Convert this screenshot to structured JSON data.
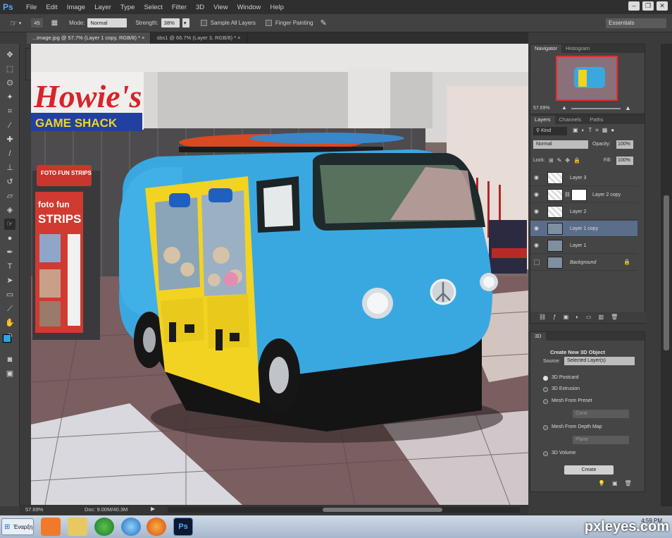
{
  "app": {
    "logo": "Ps"
  },
  "menu": [
    "File",
    "Edit",
    "Image",
    "Layer",
    "Type",
    "Select",
    "Filter",
    "3D",
    "View",
    "Window",
    "Help"
  ],
  "window_controls": {
    "minimize": "–",
    "restore": "❐",
    "close": "✕"
  },
  "options": {
    "brush_size": "45",
    "mode_label": "Mode:",
    "mode_value": "Normal",
    "strength_label": "Strength:",
    "strength_value": "38%",
    "sample_all_layers": "Sample All Layers",
    "finger_painting": "Finger Painting",
    "workspace": "Essentials"
  },
  "tabs": [
    {
      "label": "...image.jpg @ 57.7% (Layer 1 copy, RGB/8) * ×",
      "active": true
    },
    {
      "label": "sbs1 @ 66.7% (Layer 3, RGB/8) * ×",
      "active": false
    }
  ],
  "canvas_scene": {
    "sign_main": "Howie's",
    "sign_sub": "GAME SHACK",
    "booth_top": "FOTO FUN STRIPS",
    "booth_mid": "foto fun",
    "booth_big": "STRIPS"
  },
  "status": {
    "zoom": "57.69%",
    "doc": "Doc: 9.00M/40.3M"
  },
  "navigator": {
    "tabs": [
      "Navigator",
      "Histogram"
    ],
    "zoom": "57.69%"
  },
  "layers_panel": {
    "tabs": [
      "Layers",
      "Channels",
      "Paths"
    ],
    "kind": "Kind",
    "blend": "Normal",
    "opacity_label": "Opacity:",
    "opacity": "100%",
    "lock_label": "Lock:",
    "fill_label": "Fill:",
    "fill": "100%",
    "layers": [
      {
        "name": "Layer 3",
        "selected": false
      },
      {
        "name": "Layer 2 copy",
        "selected": false
      },
      {
        "name": "Layer 2",
        "selected": false
      },
      {
        "name": "Layer 1 copy",
        "selected": true
      },
      {
        "name": "Layer 1",
        "selected": false
      },
      {
        "name": "Background",
        "selected": false
      }
    ]
  },
  "threed_panel": {
    "title": "3D",
    "heading": "Create New 3D Object",
    "source_label": "Source:",
    "source_value": "Selected Layer(s)",
    "options": [
      "3D Postcard",
      "3D Extrusion",
      "Mesh From Preset",
      "Mesh From Depth Map",
      "3D Volume"
    ],
    "preset_value": "Cone",
    "depth_value": "Plane",
    "create": "Create"
  },
  "taskbar": {
    "start": "Έναρξη",
    "clock": "4:59 PM",
    "watermark": "pxleyes.com"
  },
  "colors": {
    "foreground": "#2aa6e0",
    "background": "#ffffff",
    "bus": "#3aa8e0",
    "cabinet": "#f2d321"
  }
}
